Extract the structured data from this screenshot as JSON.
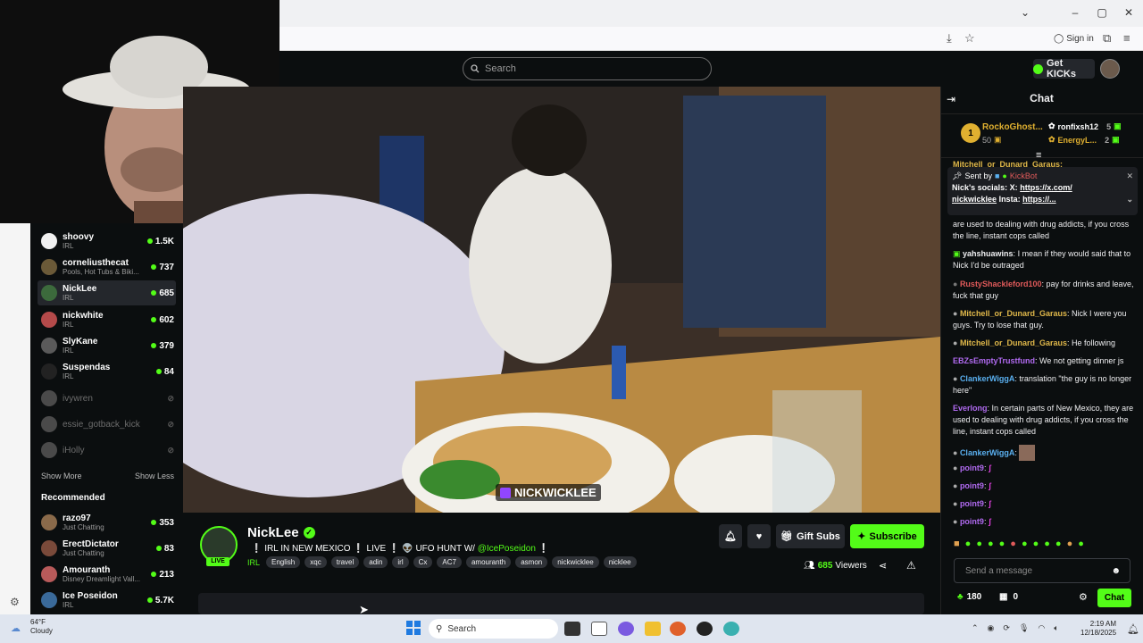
{
  "browser": {
    "signin_label": "Sign in"
  },
  "header": {
    "search_placeholder": "Search",
    "getkicks_label": "Get KICKs"
  },
  "sidebar": {
    "following": [
      {
        "name": "shoovy",
        "category": "IRL",
        "viewers": "1.5K",
        "live": true,
        "avatar_color": "#f1f1f1"
      },
      {
        "name": "corneliusthecat",
        "category": "Pools, Hot Tubs & Biki...",
        "viewers": "737",
        "live": true,
        "avatar_color": "#6b5a38"
      },
      {
        "name": "NickLee",
        "category": "IRL",
        "viewers": "685",
        "live": true,
        "avatar_color": "#3c6a3c"
      },
      {
        "name": "nickwhite",
        "category": "IRL",
        "viewers": "602",
        "live": true,
        "avatar_color": "#b44a4a"
      },
      {
        "name": "SlyKane",
        "category": "IRL",
        "viewers": "379",
        "live": true,
        "avatar_color": "#5a5a5a"
      },
      {
        "name": "Suspendas",
        "category": "IRL",
        "viewers": "84",
        "live": true,
        "avatar_color": "#222222"
      },
      {
        "name": "ivywren",
        "category": "",
        "viewers": "",
        "live": false,
        "avatar_color": "#4a4a4a"
      },
      {
        "name": "essie_gotback_kick",
        "category": "",
        "viewers": "",
        "live": false,
        "avatar_color": "#4a4a4a"
      },
      {
        "name": "iHolly",
        "category": "",
        "viewers": "",
        "live": false,
        "avatar_color": "#4a4a4a"
      }
    ],
    "show_more": "Show More",
    "show_less": "Show Less",
    "recommended_title": "Recommended",
    "recommended": [
      {
        "name": "razo97",
        "category": "Just Chatting",
        "viewers": "353",
        "avatar_color": "#8a6a4a"
      },
      {
        "name": "ErectDictator",
        "category": "Just Chatting",
        "viewers": "83",
        "avatar_color": "#7a4a3a"
      },
      {
        "name": "Amouranth",
        "category": "Disney Dreamlight Vall...",
        "viewers": "213",
        "avatar_color": "#b85a5a"
      },
      {
        "name": "Ice Poseidon",
        "category": "IRL",
        "viewers": "5.7K",
        "avatar_color": "#3a6a9a"
      }
    ]
  },
  "video": {
    "watermark": "NICKWICKLEE"
  },
  "stream": {
    "streamer": "NickLee",
    "live_label": "LIVE",
    "title_prefix": "❕ IRL IN NEW MEXICO ❕ LIVE ❕ 👽 UFO HUNT W/",
    "title_mention": "@IcePoseidon",
    "title_suffix": "❕",
    "category": "IRL",
    "tags": [
      "English",
      "xqc",
      "travel",
      "adin",
      "irl",
      "Cx",
      "AC7",
      "amouranth",
      "asmon",
      "nickwicklee",
      "nicklee"
    ],
    "gift_subs_label": "Gift Subs",
    "subscribe_label": "Subscribe",
    "viewer_count": "685",
    "viewers_label": "Viewers"
  },
  "chat": {
    "title": "Chat",
    "gifters": [
      {
        "rank": "1",
        "name": "RockoGhost...",
        "count": "50"
      },
      {
        "name": "ronfixsh12",
        "count": "5"
      },
      {
        "name": "EnergyL...",
        "count": "2"
      }
    ],
    "top_partial": "Mitchell_or_Dunard_Garaus:",
    "pinned": {
      "sent_by_label": "Sent by",
      "sender": "KickBot",
      "text1": "Nick's socials: X:",
      "link1": "https://x.com/",
      "text2": "nickwicklee",
      "text3": "Insta:",
      "link2": "https://..."
    },
    "messages": [
      {
        "user": "",
        "text": "are used to dealing with drug addicts, if you cross the line, instant cops called",
        "color": "#efeff1"
      },
      {
        "user": "yahshuawins",
        "text": "I mean if they would said that to Nick I'd be outraged",
        "color": "#ffffff"
      },
      {
        "user": "RustyShackleford100",
        "text": "pay for drinks and leave, fuck that guy",
        "color": "#e05a5a"
      },
      {
        "user": "Mitchell_or_Dunard_Garaus",
        "text": "Nick I were you guys. Try to lose that guy.",
        "color": "#e0b84a"
      },
      {
        "user": "Mitchell_or_Dunard_Garaus",
        "text": "He following",
        "color": "#e0b84a"
      },
      {
        "user": "EBZsEmptyTrustfund",
        "text": "We not getting dinner js",
        "color": "#b06af0"
      },
      {
        "user": "ClankerWiggA",
        "text": "translation \"the guy is no longer here\"",
        "color": "#5ab0f0"
      },
      {
        "user": "Everlong",
        "text": "In certain parts of New Mexico, they are used to dealing with drug addicts, if you cross the line, instant cops called",
        "color": "#b06af0"
      },
      {
        "user": "ClankerWiggA",
        "text": "",
        "color": "#5ab0f0"
      },
      {
        "user": "point9",
        "text": "",
        "color": "#b06af0"
      },
      {
        "user": "point9",
        "text": "",
        "color": "#b06af0"
      },
      {
        "user": "point9",
        "text": "",
        "color": "#b06af0"
      },
      {
        "user": "point9",
        "text": "",
        "color": "#b06af0"
      }
    ],
    "input_placeholder": "Send a message",
    "kicks_count": "180",
    "sub_count": "0",
    "chat_button": "Chat"
  },
  "taskbar": {
    "temp": "64°F",
    "condition": "Cloudy",
    "search_label": "Search",
    "time": "2:19 AM",
    "date": "12/18/2025"
  },
  "colors": {
    "accent": "#53fc18",
    "bg": "#0b0e0f"
  }
}
